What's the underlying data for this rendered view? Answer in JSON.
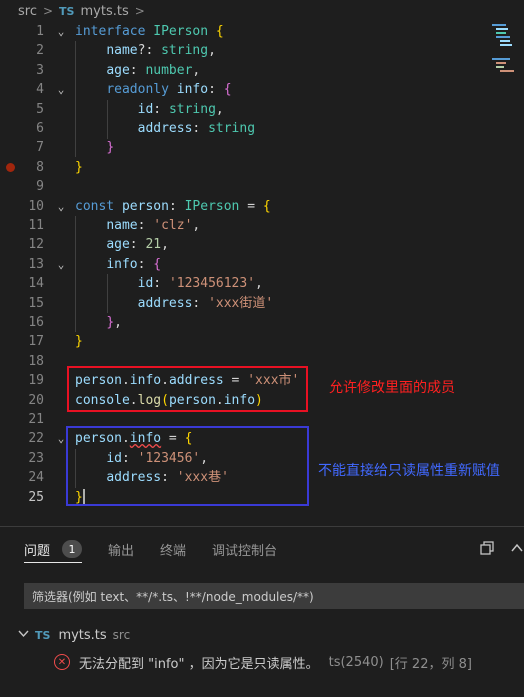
{
  "breadcrumb": {
    "folder": "src",
    "sep": ">",
    "file_badge": "TS",
    "file": "myts.ts"
  },
  "code_lines": [
    {
      "n": "1",
      "fold": "⌄",
      "tokens": [
        [
          "kw",
          "interface "
        ],
        [
          "ty",
          "IPerson "
        ],
        [
          "br1",
          "{"
        ]
      ]
    },
    {
      "n": "2",
      "fold": "",
      "tokens": [
        [
          "",
          "    "
        ],
        [
          "pr",
          "name"
        ],
        [
          "",
          "?: "
        ],
        [
          "ty",
          "string"
        ],
        [
          "",
          ","
        ]
      ]
    },
    {
      "n": "3",
      "fold": "",
      "tokens": [
        [
          "",
          "    "
        ],
        [
          "pr",
          "age"
        ],
        [
          "",
          ": "
        ],
        [
          "ty",
          "number"
        ],
        [
          "",
          ","
        ]
      ]
    },
    {
      "n": "4",
      "fold": "⌄",
      "tokens": [
        [
          "",
          "    "
        ],
        [
          "kw",
          "readonly "
        ],
        [
          "pr",
          "info"
        ],
        [
          "",
          ": "
        ],
        [
          "br2",
          "{"
        ]
      ]
    },
    {
      "n": "5",
      "fold": "",
      "tokens": [
        [
          "",
          "        "
        ],
        [
          "pr",
          "id"
        ],
        [
          "",
          ": "
        ],
        [
          "ty",
          "string"
        ],
        [
          "",
          ","
        ]
      ]
    },
    {
      "n": "6",
      "fold": "",
      "tokens": [
        [
          "",
          "        "
        ],
        [
          "pr",
          "address"
        ],
        [
          "",
          ": "
        ],
        [
          "ty",
          "string"
        ]
      ]
    },
    {
      "n": "7",
      "fold": "",
      "tokens": [
        [
          "",
          "    "
        ],
        [
          "br2",
          "}"
        ]
      ]
    },
    {
      "n": "8",
      "fold": "",
      "bp": true,
      "tokens": [
        [
          "br1",
          "}"
        ]
      ]
    },
    {
      "n": "9",
      "fold": "",
      "tokens": []
    },
    {
      "n": "10",
      "fold": "⌄",
      "tokens": [
        [
          "kw",
          "const "
        ],
        [
          "pr",
          "person"
        ],
        [
          "",
          ": "
        ],
        [
          "ty",
          "IPerson "
        ],
        [
          "",
          "= "
        ],
        [
          "br1",
          "{"
        ]
      ]
    },
    {
      "n": "11",
      "fold": "",
      "tokens": [
        [
          "",
          "    "
        ],
        [
          "pr",
          "name"
        ],
        [
          "",
          ": "
        ],
        [
          "st",
          "'clz'"
        ],
        [
          "",
          ","
        ]
      ]
    },
    {
      "n": "12",
      "fold": "",
      "tokens": [
        [
          "",
          "    "
        ],
        [
          "pr",
          "age"
        ],
        [
          "",
          ": "
        ],
        [
          "nu",
          "21"
        ],
        [
          "",
          ","
        ]
      ]
    },
    {
      "n": "13",
      "fold": "⌄",
      "tokens": [
        [
          "",
          "    "
        ],
        [
          "pr",
          "info"
        ],
        [
          "",
          ": "
        ],
        [
          "br2",
          "{"
        ]
      ]
    },
    {
      "n": "14",
      "fold": "",
      "tokens": [
        [
          "",
          "        "
        ],
        [
          "pr",
          "id"
        ],
        [
          "",
          ": "
        ],
        [
          "st",
          "'123456123'"
        ],
        [
          "",
          ","
        ]
      ]
    },
    {
      "n": "15",
      "fold": "",
      "tokens": [
        [
          "",
          "        "
        ],
        [
          "pr",
          "address"
        ],
        [
          "",
          ": "
        ],
        [
          "st",
          "'xxx街道'"
        ]
      ]
    },
    {
      "n": "16",
      "fold": "",
      "tokens": [
        [
          "",
          "    "
        ],
        [
          "br2",
          "}"
        ],
        [
          "",
          ","
        ]
      ]
    },
    {
      "n": "17",
      "fold": "",
      "tokens": [
        [
          "br1",
          "}"
        ]
      ]
    },
    {
      "n": "18",
      "fold": "",
      "tokens": []
    },
    {
      "n": "19",
      "fold": "",
      "tokens": [
        [
          "pr",
          "person"
        ],
        [
          "",
          "."
        ],
        [
          "pr",
          "info"
        ],
        [
          "",
          "."
        ],
        [
          "pr",
          "address"
        ],
        [
          "",
          " = "
        ],
        [
          "st",
          "'xxx市'"
        ]
      ]
    },
    {
      "n": "20",
      "fold": "",
      "tokens": [
        [
          "pr",
          "console"
        ],
        [
          "",
          "."
        ],
        [
          "fn",
          "log"
        ],
        [
          "br1",
          "("
        ],
        [
          "pr",
          "person"
        ],
        [
          "",
          "."
        ],
        [
          "pr",
          "info"
        ],
        [
          "br1",
          ")"
        ]
      ]
    },
    {
      "n": "21",
      "fold": "",
      "tokens": []
    },
    {
      "n": "22",
      "fold": "⌄",
      "tokens": [
        [
          "pr",
          "person"
        ],
        [
          "",
          "."
        ],
        [
          "pr squig",
          "info"
        ],
        [
          "",
          " = "
        ],
        [
          "br1",
          "{"
        ]
      ]
    },
    {
      "n": "23",
      "fold": "",
      "tokens": [
        [
          "",
          "    "
        ],
        [
          "pr",
          "id"
        ],
        [
          "",
          ": "
        ],
        [
          "st",
          "'123456'"
        ],
        [
          "",
          ","
        ]
      ]
    },
    {
      "n": "24",
      "fold": "",
      "tokens": [
        [
          "",
          "    "
        ],
        [
          "pr",
          "address"
        ],
        [
          "",
          ": "
        ],
        [
          "st",
          "'xxx巷'"
        ]
      ]
    },
    {
      "n": "25",
      "fold": "",
      "active": true,
      "tokens": [
        [
          "br1",
          "}"
        ]
      ]
    }
  ],
  "annotations": {
    "red_note": "允许修改里面的成员",
    "blue_note": "不能直接给只读属性重新赋值"
  },
  "panel": {
    "tabs": [
      {
        "label": "问题",
        "badge": "1",
        "active": true
      },
      {
        "label": "输出",
        "active": false
      },
      {
        "label": "终端",
        "active": false
      },
      {
        "label": "调试控制台",
        "active": false
      }
    ],
    "icons": [
      "copy-icon",
      "chevron-up-icon"
    ],
    "filter_placeholder": "筛选器(例如 text、**/*.ts、!**/node_modules/**)",
    "file_badge": "TS",
    "file_name": "myts.ts",
    "file_dir": "src",
    "error": {
      "icon_glyph": "✕",
      "message": "无法分配到 \"info\" ，因为它是只读属性。",
      "source": "ts(2540)",
      "position": "[行 22，列 8]"
    }
  },
  "colors": {
    "background": "#1e1e1e",
    "keyword": "#569cd6",
    "type": "#4ec9b0",
    "property": "#9cdcfe",
    "string": "#ce9178",
    "number": "#b5cea8",
    "error": "#f14c4c",
    "red_box": "#e81123",
    "blue_box": "#3a3ad6"
  }
}
